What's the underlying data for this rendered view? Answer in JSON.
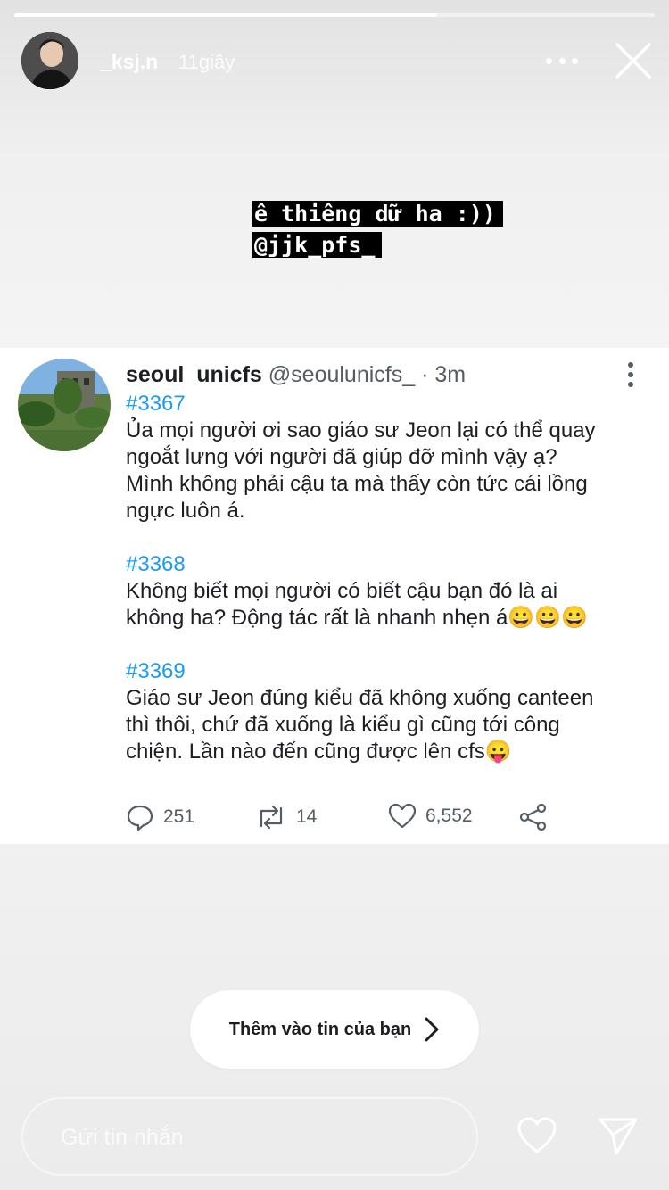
{
  "story": {
    "progress": 0.66,
    "username": "_ksj.n",
    "time_ago": "11giây",
    "caption_lines": [
      "ê thiêng dữ ha :))",
      "@jjk_pfs_"
    ]
  },
  "tweet": {
    "display_name": "seoul_unicfs",
    "handle": "@seoulunicfs_",
    "time": "· 3m",
    "posts": [
      {
        "tag": "#3367",
        "lines": [
          "Ủa mọi người ơi sao giáo sư Jeon lại có thể quay",
          "ngoắt lưng với người đã giúp đỡ mình vậy ạ?",
          "Mình không phải cậu ta mà thấy còn tức cái lồng",
          "ngực luôn á."
        ]
      },
      {
        "tag": "#3368",
        "lines": [
          "Không biết mọi người có biết cậu bạn đó là ai",
          "không ha? Động tác rất là nhanh nhẹn á😀😀😀"
        ]
      },
      {
        "tag": "#3369",
        "lines": [
          "Giáo sư Jeon đúng kiểu đã không xuống canteen",
          "thì thôi, chứ đã xuống là kiểu gì cũng tới công",
          "chiện. Lần nào đến cũng được lên cfs😛"
        ]
      }
    ],
    "stats": {
      "replies": "251",
      "retweets": "14",
      "likes": "6,552"
    }
  },
  "add_to_story_label": "Thêm vào tin của bạn",
  "message_placeholder": "Gửi tin nhắn",
  "colors": {
    "accent": "#1d9bf0",
    "text": "#1c1e21",
    "muted": "#555c63"
  }
}
